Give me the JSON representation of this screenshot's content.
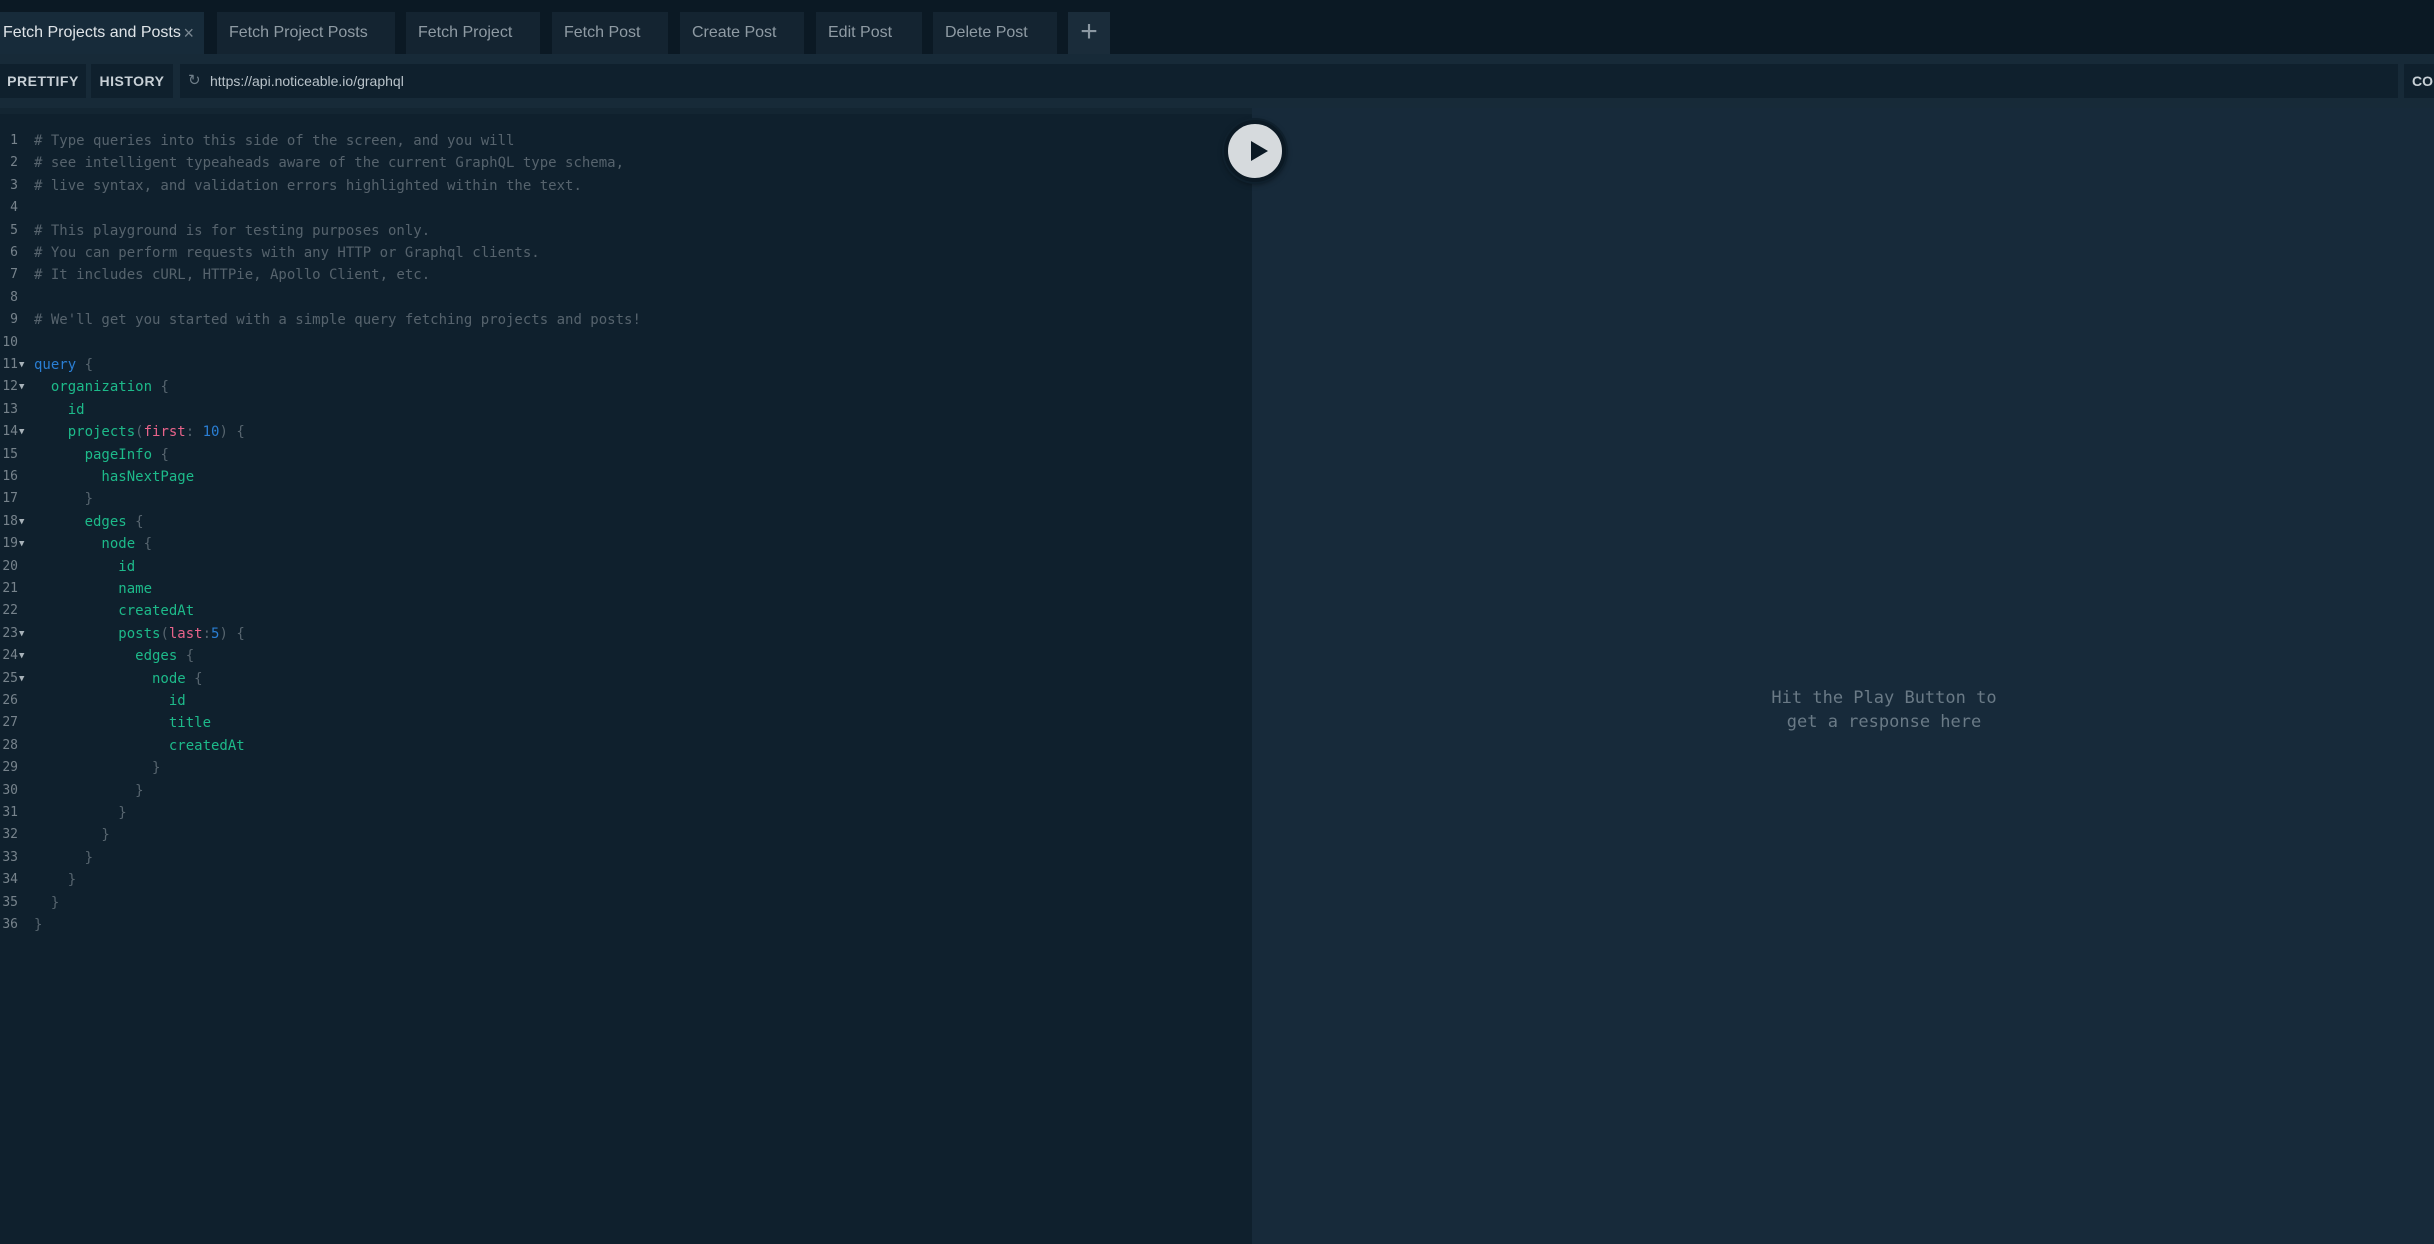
{
  "tabs": [
    {
      "label": "Fetch Projects and Posts",
      "active": true
    },
    {
      "label": "Fetch Project Posts"
    },
    {
      "label": "Fetch Project"
    },
    {
      "label": "Fetch Post"
    },
    {
      "label": "Create Post"
    },
    {
      "label": "Edit Post"
    },
    {
      "label": "Delete Post"
    }
  ],
  "tab_close_icon": "×",
  "tab_add_icon": "+",
  "toolbar": {
    "prettify_label": "PRETTIFY",
    "history_label": "HISTORY",
    "reload_icon": "↻",
    "url": "https://api.noticeable.io/graphql",
    "right_button_label": "CO"
  },
  "editor": {
    "fold_icon": "▼",
    "lines": [
      {
        "n": "1",
        "tokens": [
          {
            "t": "# Type queries into this side of the screen, and you will",
            "c": "comment"
          }
        ]
      },
      {
        "n": "2",
        "tokens": [
          {
            "t": "# see intelligent typeaheads aware of the current GraphQL type schema,",
            "c": "comment"
          }
        ]
      },
      {
        "n": "3",
        "tokens": [
          {
            "t": "# live syntax, and validation errors highlighted within the text.",
            "c": "comment"
          }
        ]
      },
      {
        "n": "4",
        "tokens": []
      },
      {
        "n": "5",
        "tokens": [
          {
            "t": "# This playground is for testing purposes only.",
            "c": "comment"
          }
        ]
      },
      {
        "n": "6",
        "tokens": [
          {
            "t": "# You can perform requests with any HTTP or Graphql clients.",
            "c": "comment"
          }
        ]
      },
      {
        "n": "7",
        "tokens": [
          {
            "t": "# It includes cURL, HTTPie, Apollo Client, etc.",
            "c": "comment"
          }
        ]
      },
      {
        "n": "8",
        "tokens": []
      },
      {
        "n": "9",
        "tokens": [
          {
            "t": "# We'll get you started with a simple query fetching projects and posts!",
            "c": "comment"
          }
        ]
      },
      {
        "n": "10",
        "tokens": []
      },
      {
        "n": "11",
        "fold": true,
        "tokens": [
          {
            "t": "query",
            "c": "keyword"
          },
          {
            "t": " {",
            "c": "punct"
          }
        ]
      },
      {
        "n": "12",
        "fold": true,
        "tokens": [
          {
            "t": "  organization",
            "c": "field"
          },
          {
            "t": " {",
            "c": "punct"
          }
        ]
      },
      {
        "n": "13",
        "tokens": [
          {
            "t": "    id",
            "c": "field"
          }
        ]
      },
      {
        "n": "14",
        "fold": true,
        "tokens": [
          {
            "t": "    projects",
            "c": "field"
          },
          {
            "t": "(",
            "c": "punct"
          },
          {
            "t": "first",
            "c": "arg"
          },
          {
            "t": ": ",
            "c": "punct"
          },
          {
            "t": "10",
            "c": "num"
          },
          {
            "t": ") {",
            "c": "punct"
          }
        ]
      },
      {
        "n": "15",
        "tokens": [
          {
            "t": "      pageInfo",
            "c": "field"
          },
          {
            "t": " {",
            "c": "punct"
          }
        ]
      },
      {
        "n": "16",
        "tokens": [
          {
            "t": "        hasNextPage",
            "c": "field"
          }
        ]
      },
      {
        "n": "17",
        "tokens": [
          {
            "t": "      }",
            "c": "punct"
          }
        ]
      },
      {
        "n": "18",
        "fold": true,
        "tokens": [
          {
            "t": "      edges",
            "c": "field"
          },
          {
            "t": " {",
            "c": "punct"
          }
        ]
      },
      {
        "n": "19",
        "fold": true,
        "tokens": [
          {
            "t": "        node",
            "c": "field"
          },
          {
            "t": " {",
            "c": "punct"
          }
        ]
      },
      {
        "n": "20",
        "tokens": [
          {
            "t": "          id",
            "c": "field"
          }
        ]
      },
      {
        "n": "21",
        "tokens": [
          {
            "t": "          name",
            "c": "field"
          }
        ]
      },
      {
        "n": "22",
        "tokens": [
          {
            "t": "          createdAt",
            "c": "field"
          }
        ]
      },
      {
        "n": "23",
        "fold": true,
        "tokens": [
          {
            "t": "          posts",
            "c": "field"
          },
          {
            "t": "(",
            "c": "punct"
          },
          {
            "t": "last",
            "c": "arg"
          },
          {
            "t": ":",
            "c": "punct"
          },
          {
            "t": "5",
            "c": "num"
          },
          {
            "t": ") {",
            "c": "punct"
          }
        ]
      },
      {
        "n": "24",
        "fold": true,
        "tokens": [
          {
            "t": "            edges",
            "c": "field"
          },
          {
            "t": " {",
            "c": "punct"
          }
        ]
      },
      {
        "n": "25",
        "fold": true,
        "tokens": [
          {
            "t": "              node",
            "c": "field"
          },
          {
            "t": " {",
            "c": "punct"
          }
        ]
      },
      {
        "n": "26",
        "tokens": [
          {
            "t": "                id",
            "c": "field"
          }
        ]
      },
      {
        "n": "27",
        "tokens": [
          {
            "t": "                title",
            "c": "field"
          }
        ]
      },
      {
        "n": "28",
        "tokens": [
          {
            "t": "                createdAt",
            "c": "field"
          }
        ]
      },
      {
        "n": "29",
        "tokens": [
          {
            "t": "              }",
            "c": "punct"
          }
        ]
      },
      {
        "n": "30",
        "tokens": [
          {
            "t": "            }",
            "c": "punct"
          }
        ]
      },
      {
        "n": "31",
        "tokens": [
          {
            "t": "          }",
            "c": "punct"
          }
        ]
      },
      {
        "n": "32",
        "tokens": [
          {
            "t": "        }",
            "c": "punct"
          }
        ]
      },
      {
        "n": "33",
        "tokens": [
          {
            "t": "      }",
            "c": "punct"
          }
        ]
      },
      {
        "n": "34",
        "tokens": [
          {
            "t": "    }",
            "c": "punct"
          }
        ]
      },
      {
        "n": "35",
        "tokens": [
          {
            "t": "  }",
            "c": "punct"
          }
        ]
      },
      {
        "n": "36",
        "tokens": [
          {
            "t": "}",
            "c": "punct"
          }
        ]
      }
    ]
  },
  "result": {
    "message_line1": "Hit the Play Button to",
    "message_line2": "get a response here"
  }
}
